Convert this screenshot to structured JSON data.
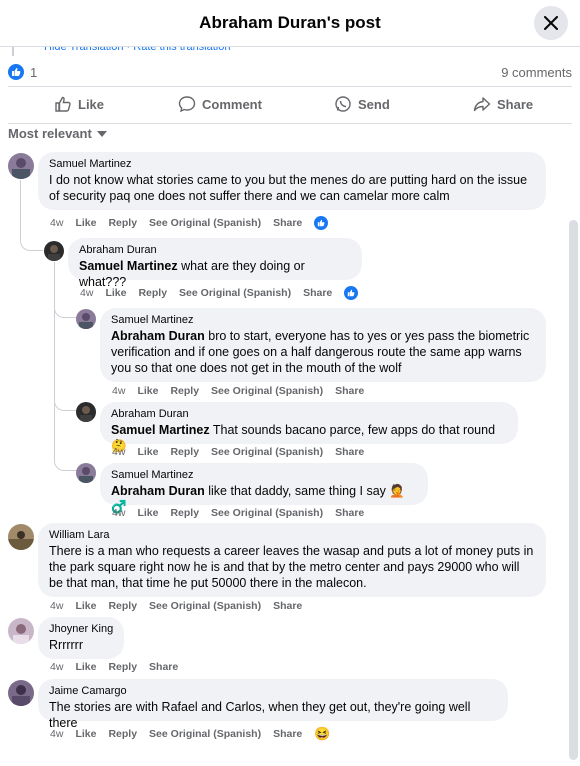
{
  "header": {
    "title": "Abraham Duran's post"
  },
  "translation": {
    "text": "Hide Translation · Rate this translation"
  },
  "reactions": {
    "count": "1",
    "comments": "9 comments"
  },
  "actions": {
    "like": "Like",
    "comment": "Comment",
    "send": "Send",
    "share": "Share"
  },
  "sort": {
    "label": "Most relevant"
  },
  "comments": [
    {
      "author": "Samuel Martinez",
      "text": "I do not know what stories came to you but the menes do are putting hard on the issue of security paq one does not suffer there and we can camelar more calm",
      "time": "4w",
      "like": "Like",
      "reply": "Reply",
      "see_original": "See Original (Spanish)",
      "share": "Share",
      "replies": [
        {
          "author": "Abraham Duran",
          "mention": "Samuel Martinez",
          "text": " what are they doing or what???",
          "time": "4w",
          "like": "Like",
          "reply": "Reply",
          "see_original": "See Original (Spanish)",
          "share": "Share"
        },
        {
          "author": "Samuel Martinez",
          "mention": "Abraham Duran",
          "text": " bro to start, everyone has to yes or yes pass the biometric verification and if one goes on a half dangerous route the same app warns you so that one does not get in the mouth of the wolf",
          "time": "4w",
          "like": "Like",
          "reply": "Reply",
          "see_original": "See Original (Spanish)",
          "share": "Share"
        },
        {
          "author": "Abraham Duran",
          "mention": "Samuel Martinez",
          "text": " That sounds bacano parce, few apps do that round 🤔",
          "time": "4w",
          "like": "Like",
          "reply": "Reply",
          "see_original": "See Original (Spanish)",
          "share": "Share"
        },
        {
          "author": "Samuel Martinez",
          "mention": "Abraham Duran",
          "text": " like that daddy, same thing I say 🤦 ♂️",
          "time": "4w",
          "like": "Like",
          "reply": "Reply",
          "see_original": "See Original (Spanish)",
          "share": "Share"
        }
      ]
    },
    {
      "author": "William Lara",
      "text": "There is a man who requests a career leaves the wasap and puts a lot of money puts in the park square right now he is and that by the metro center and pays 29000 who will be that man, that time he put 50000 there in the malecon.",
      "time": "4w",
      "like": "Like",
      "reply": "Reply",
      "see_original": "See Original (Spanish)",
      "share": "Share"
    },
    {
      "author": "Jhoyner King",
      "text": "Rrrrrrr",
      "time": "4w",
      "like": "Like",
      "reply": "Reply",
      "share": "Share"
    },
    {
      "author": "Jaime Camargo",
      "text": "The stories are with Rafael and Carlos, when they get out, they're going well there",
      "time": "4w",
      "like": "Like",
      "reply": "Reply",
      "see_original": "See Original (Spanish)",
      "share": "Share",
      "reaction": "😆"
    }
  ],
  "colors": {
    "accent": "#1877f2",
    "bubble": "#f0f2f5",
    "muted": "#65676b"
  }
}
